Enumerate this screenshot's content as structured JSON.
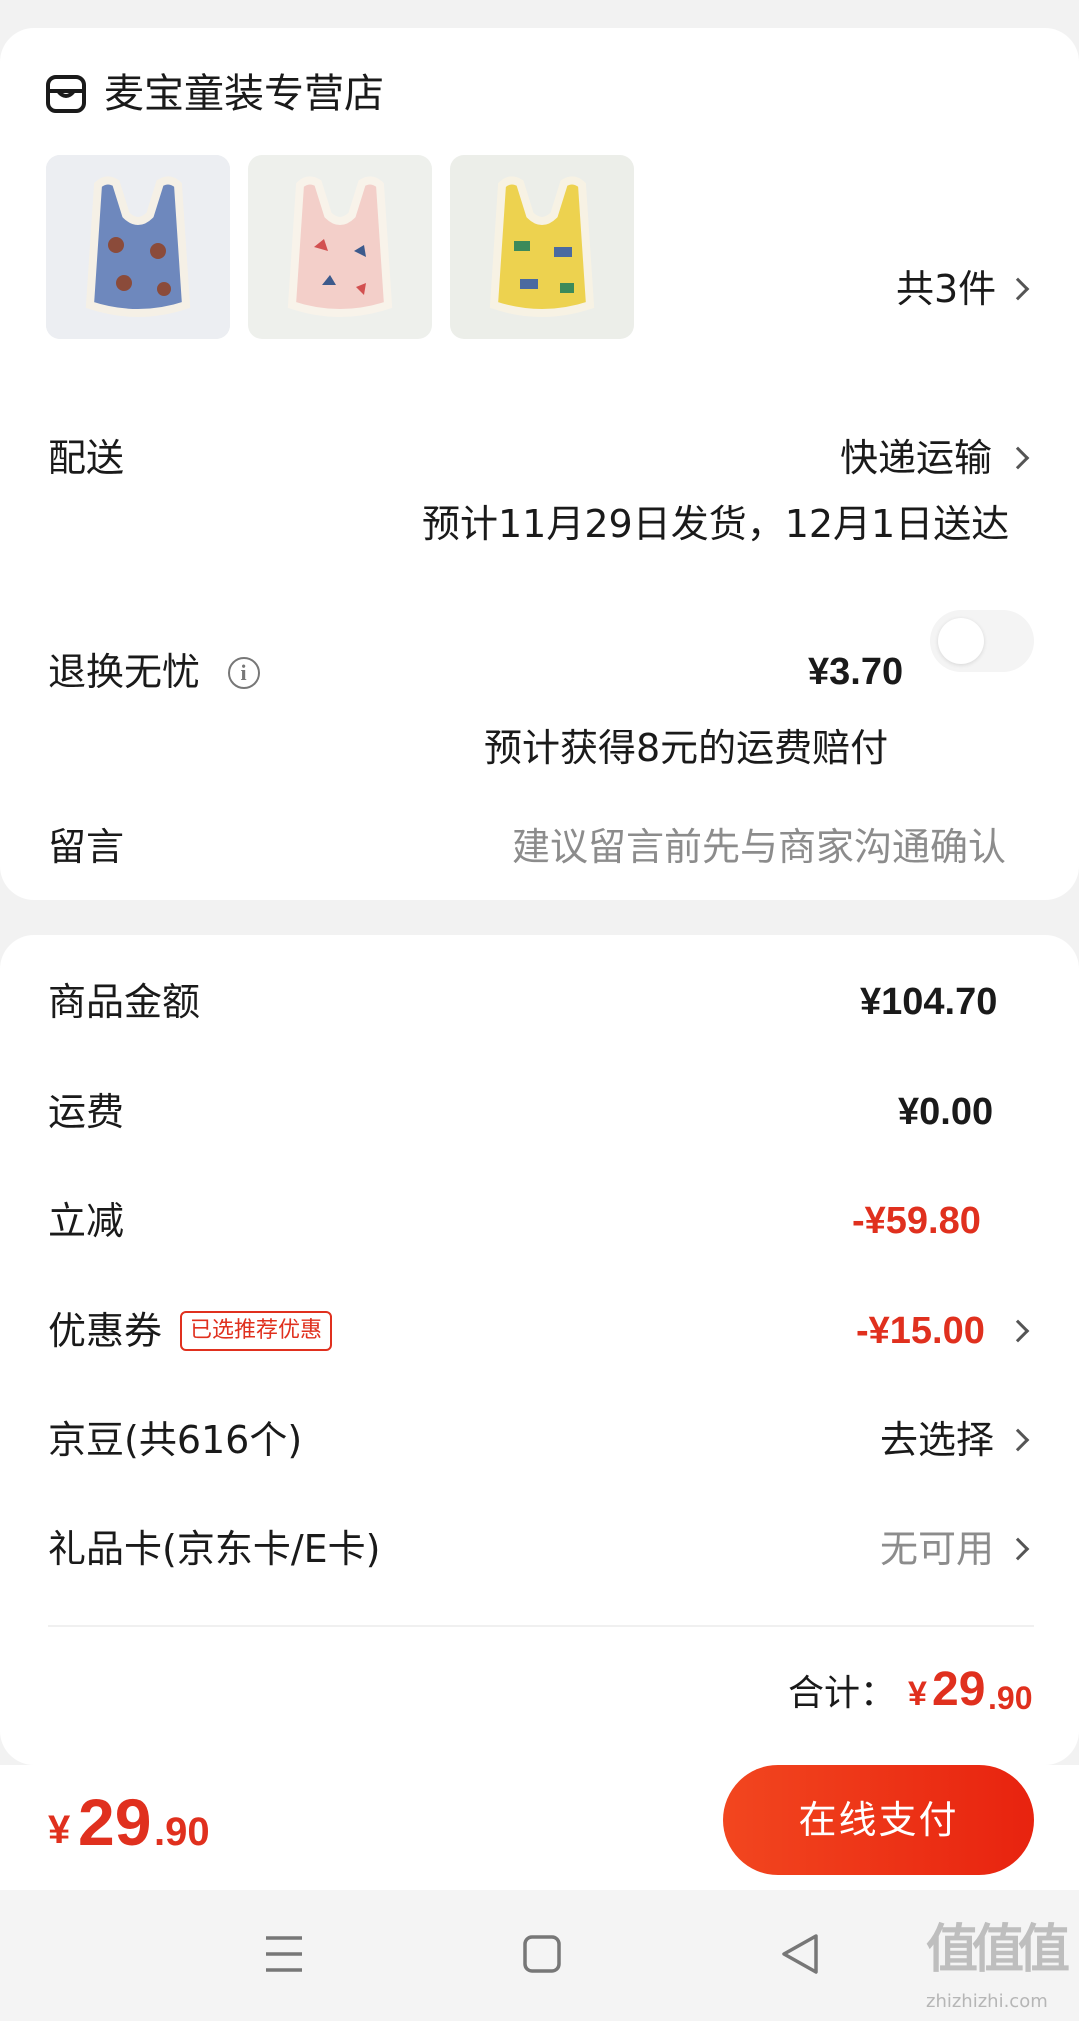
{
  "store": {
    "name": "麦宝童装专营店",
    "icon": "store-icon"
  },
  "products": {
    "count_label": "共3件",
    "items": [
      {
        "name": "blue-vest",
        "color": "#6e88bd"
      },
      {
        "name": "pink-vest",
        "color": "#f3cfc9"
      },
      {
        "name": "yellow-vest",
        "color": "#edd24f"
      }
    ]
  },
  "delivery": {
    "label": "配送",
    "method": "快递运输",
    "estimate": "预计11月29日发货，12月1日送达"
  },
  "return_insurance": {
    "label": "退换无忧",
    "price": "¥3.70",
    "note": "预计获得8元的运费赔付"
  },
  "message": {
    "label": "留言",
    "placeholder": "建议留言前先与商家沟通确认"
  },
  "summary": {
    "goods_label": "商品金额",
    "goods_value": "¥104.70",
    "shipping_label": "运费",
    "shipping_value": "¥0.00",
    "discount_label": "立减",
    "discount_value": "-¥59.80",
    "coupon_label": "优惠券",
    "coupon_tag": "已选推荐优惠",
    "coupon_value": "-¥15.00",
    "beans_label": "京豆(共616个)",
    "beans_value": "去选择",
    "giftcard_label": "礼品卡(京东卡/E卡)",
    "giftcard_value": "无可用",
    "total_label": "合计：",
    "total_currency": "¥",
    "total_int": "29",
    "total_dec": ".90"
  },
  "bottom_bar": {
    "currency": "¥",
    "price_int": "29",
    "price_dec": ".90",
    "pay_button": "在线支付"
  },
  "nav": {
    "menu": "menu-icon",
    "home": "home-square-icon",
    "back": "back-triangle-icon"
  },
  "watermark": {
    "title": "值值值",
    "url": "zhizhizhi.com"
  },
  "colors": {
    "accent": "#e0301e",
    "button": "#ec2f14",
    "background": "#f2f2f2"
  }
}
